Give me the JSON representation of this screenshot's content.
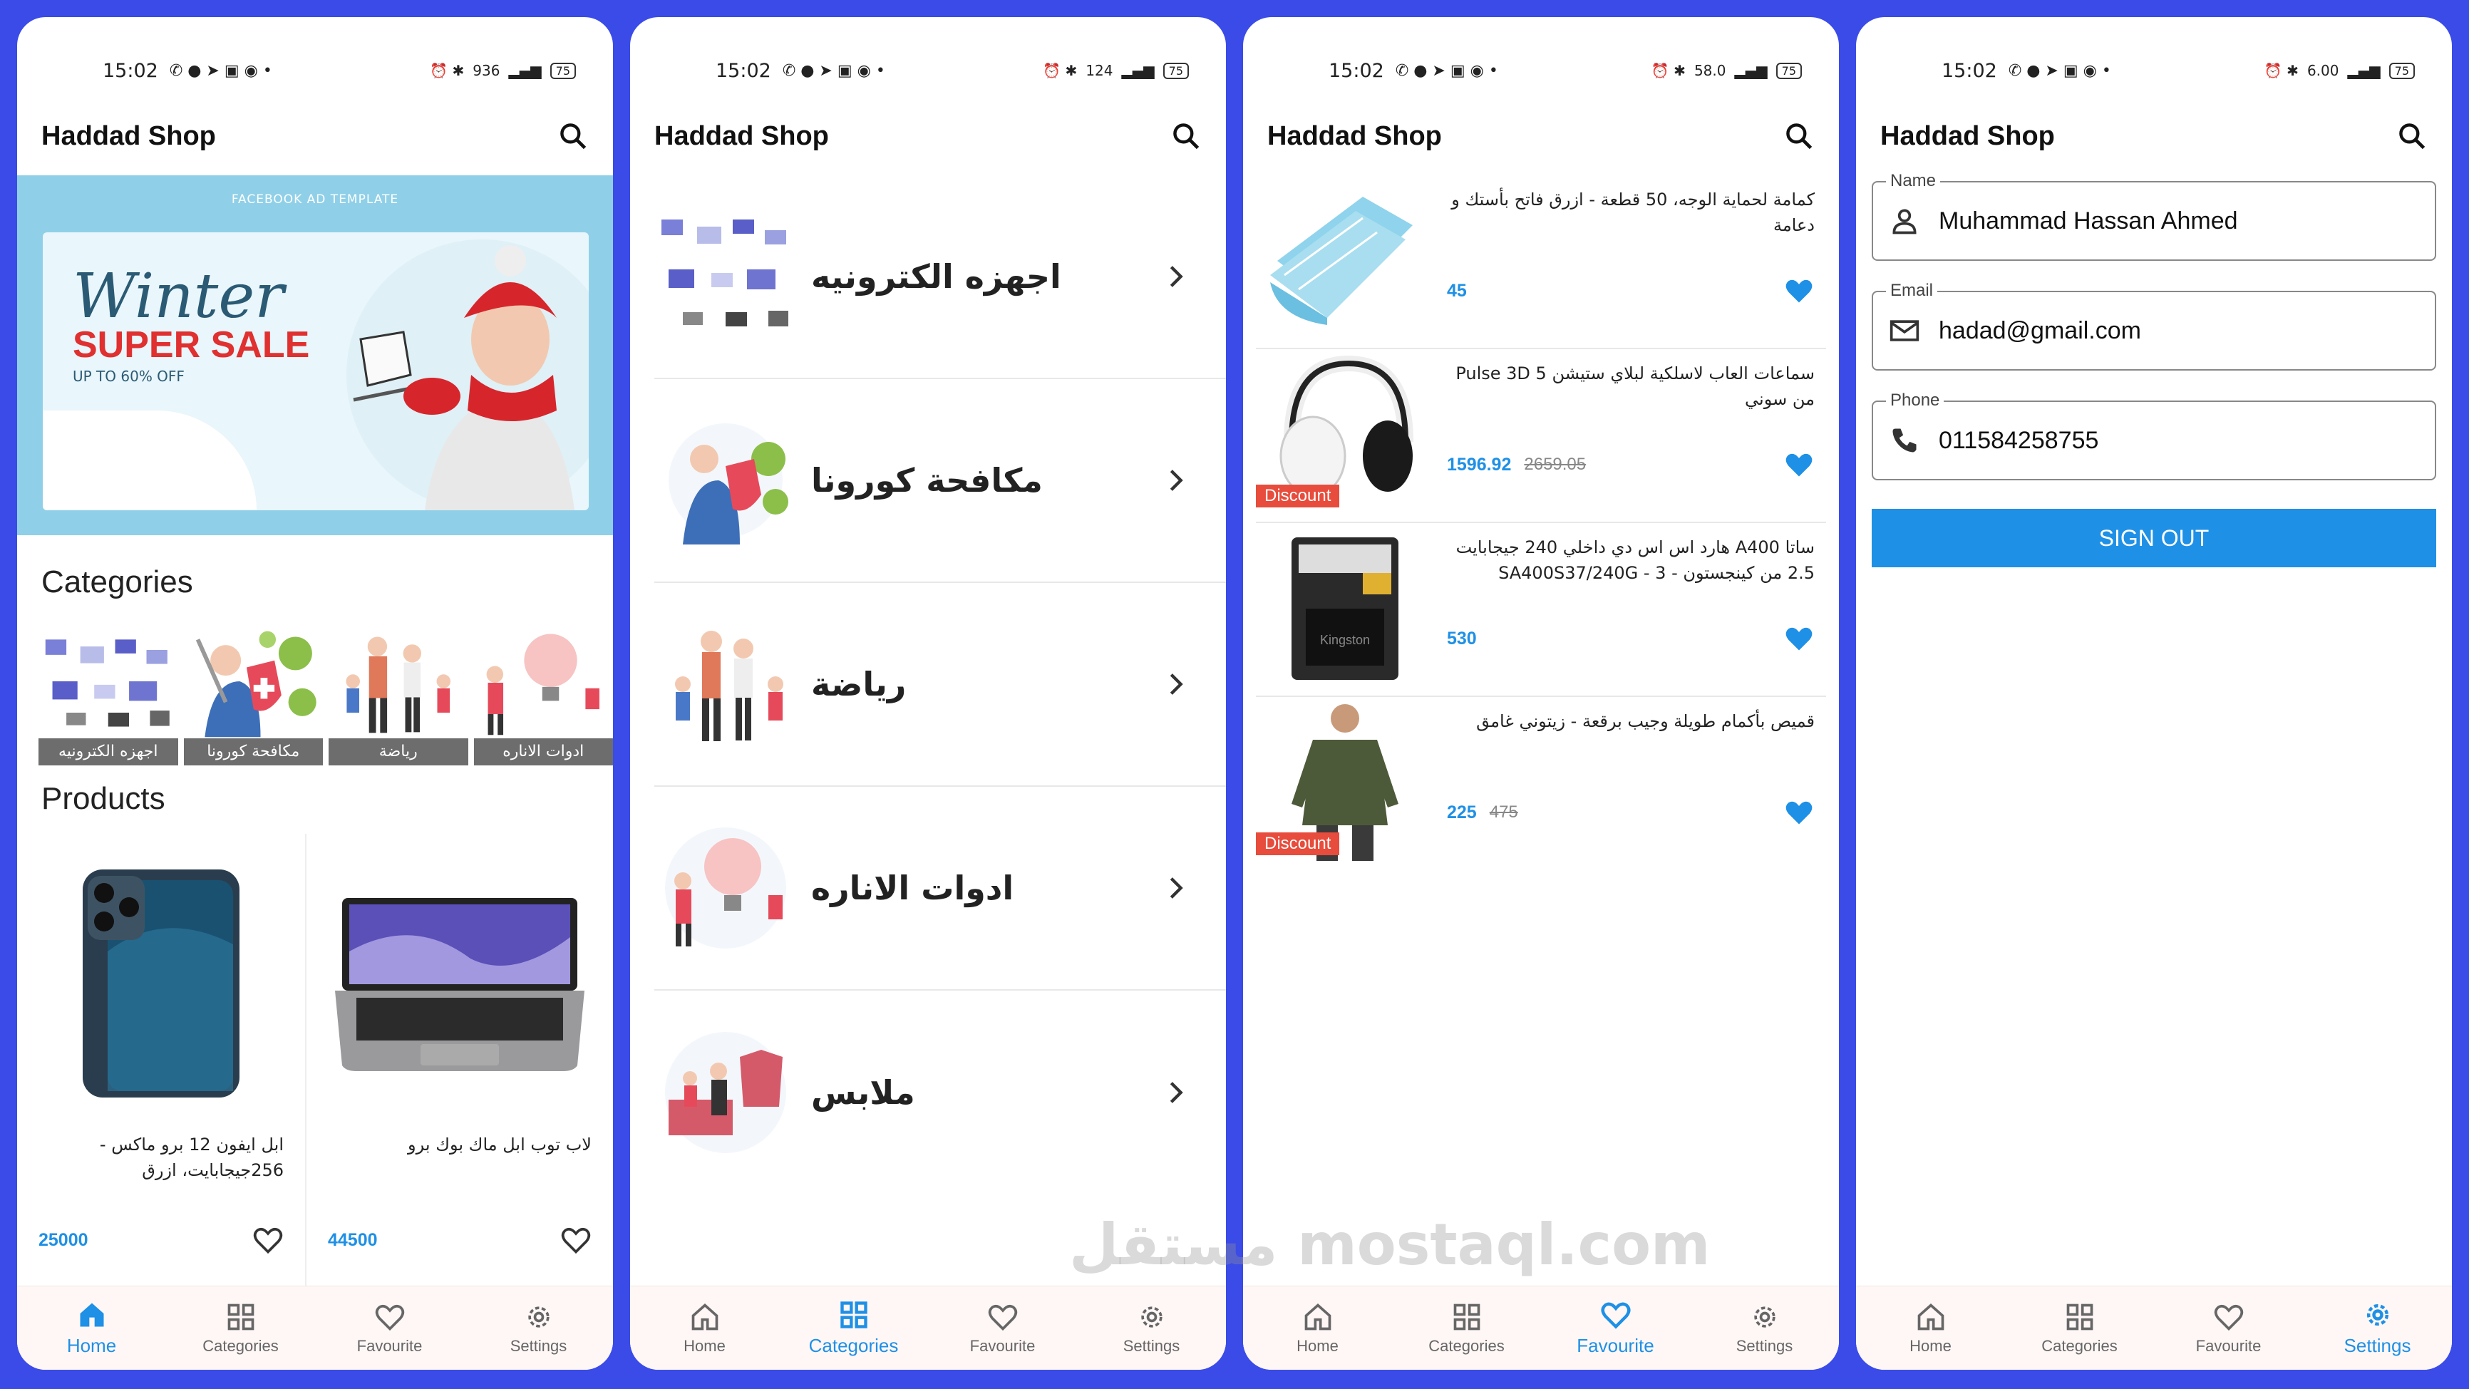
{
  "status": {
    "time": "15:02",
    "battery": "75",
    "speeds": [
      "936",
      "124",
      "58.0",
      "6.00"
    ]
  },
  "app_title": "Haddad Shop",
  "nav": {
    "home": "Home",
    "categories": "Categories",
    "favourite": "Favourite",
    "settings": "Settings"
  },
  "home": {
    "banner": {
      "template": "FACEBOOK AD TEMPLATE",
      "winter": "Winter",
      "super": "SUPER SALE",
      "upto": "UP TO 60% OFF"
    },
    "categories_title": "Categories",
    "categories": [
      "اجهزه الكترونيه",
      "مكافحة كورونا",
      "رياضة",
      "ادوات الاناره"
    ],
    "products_title": "Products",
    "products": [
      {
        "name": "ابل ايفون 12 برو ماكس - 256جيجابايت، ازرق",
        "price": "25000"
      },
      {
        "name": "لاب توب ابل ماك بوك برو",
        "price": "44500"
      }
    ]
  },
  "categories_screen": [
    "اجهزه الكترونيه",
    "مكافحة كورونا",
    "رياضة",
    "ادوات الاناره",
    "ملابس"
  ],
  "favourites": {
    "discount_label": "Discount",
    "items": [
      {
        "name": "كمامة لحماية الوجه، 50 قطعة - ازرق فاتح بأستك و دعامة",
        "price": "45",
        "old_price": "",
        "discount": false
      },
      {
        "name": "سماعات العاب لاسلكية لبلاي ستيشن 5 Pulse 3D من سوني",
        "price": "1596.92",
        "old_price": "2659.05",
        "discount": true
      },
      {
        "name": "ساتا A400 هارد اس اس دي داخلي 240 جيجابايت 2.5 من كينجستون - 3 - SA400S37/240G",
        "price": "530",
        "old_price": "",
        "discount": false
      },
      {
        "name": "قميص بأكمام طويلة وجيب برقعة - زيتوني غامق",
        "price": "225",
        "old_price": "475",
        "discount": true
      }
    ]
  },
  "settings": {
    "name_label": "Name",
    "name": "Muhammad Hassan Ahmed",
    "email_label": "Email",
    "email": "hadad@gmail.com",
    "phone_label": "Phone",
    "phone": "011584258755",
    "signout": "SIGN OUT"
  },
  "watermark": "مستقل mostaql.com",
  "colors": {
    "accent": "#1e90e6",
    "background": "#3a4be8",
    "discount": "#e74c3c"
  }
}
